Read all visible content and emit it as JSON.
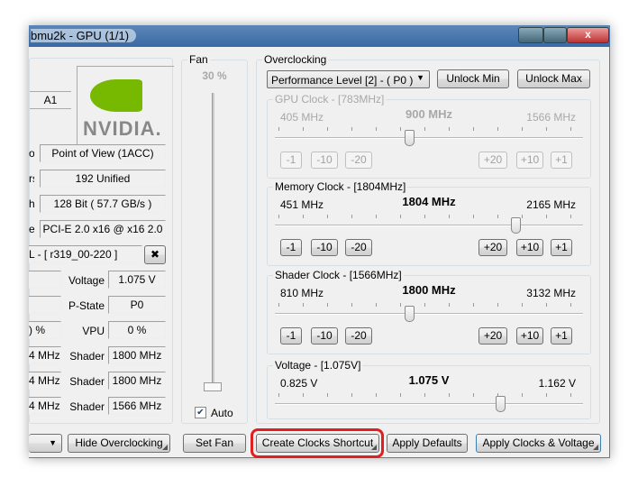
{
  "window": {
    "title": "bmu2k - GPU (1/1)"
  },
  "info": {
    "revision": "A1",
    "logo": "NVIDIA.",
    "rows": [
      {
        "label": "or",
        "value": "Point of View (1ACC)"
      },
      {
        "label": "rs",
        "value": "192 Unified"
      },
      {
        "label": "h",
        "value": "128 Bit ( 57.7 GB/s )"
      },
      {
        "label": "e",
        "value": "PCI-E 2.0 x16 @ x16 2.0"
      }
    ],
    "bios": "L - [ r319_00-220 ]",
    "stats": [
      {
        "left": "",
        "label": "Voltage",
        "value": "1.075 V"
      },
      {
        "left": "",
        "label": "P-State",
        "value": "P0"
      },
      {
        "left": ") %",
        "label": "VPU",
        "value": "0 %"
      },
      {
        "left": "4 MHz",
        "label": "Shader",
        "value": "1800 MHz"
      },
      {
        "left": "4 MHz",
        "label": "Shader",
        "value": "1800 MHz"
      },
      {
        "left": "4 MHz",
        "label": "Shader",
        "value": "1566 MHz"
      }
    ]
  },
  "fan": {
    "title": "Fan",
    "value": "30 %",
    "level_percent": 0,
    "auto_label": "Auto",
    "auto_checked": true
  },
  "oc": {
    "title": "Overclocking",
    "perf_level": "Performance Level [2] - ( P0 )",
    "unlock_min": "Unlock Min",
    "unlock_max": "Unlock Max",
    "sliders": [
      {
        "title": "GPU Clock - [783MHz]",
        "min": "405 MHz",
        "current": "900 MHz",
        "max": "1566 MHz",
        "fraction": 0.43,
        "enabled": false
      },
      {
        "title": "Memory Clock - [1804MHz]",
        "min": "451 MHz",
        "current": "1804 MHz",
        "max": "2165 MHz",
        "fraction": 0.79,
        "enabled": true
      },
      {
        "title": "Shader Clock - [1566MHz]",
        "min": "810 MHz",
        "current": "1800 MHz",
        "max": "3132 MHz",
        "fraction": 0.43,
        "enabled": true
      },
      {
        "title": "Voltage - [1.075V]",
        "min": "0.825 V",
        "current": "1.075 V",
        "max": "1.162 V",
        "fraction": 0.74,
        "enabled": true
      }
    ],
    "steps": [
      "-1",
      "-10",
      "-20",
      "+20",
      "+10",
      "+1"
    ]
  },
  "bottom": {
    "hide_oc": "Hide Overclocking",
    "set_fan": "Set Fan",
    "create_shortcut": "Create Clocks Shortcut",
    "apply_defaults": "Apply Defaults",
    "apply_clocks": "Apply Clocks & Voltage"
  },
  "colors": {
    "highlight": "#e02020",
    "nvidia_green": "#76b900"
  }
}
